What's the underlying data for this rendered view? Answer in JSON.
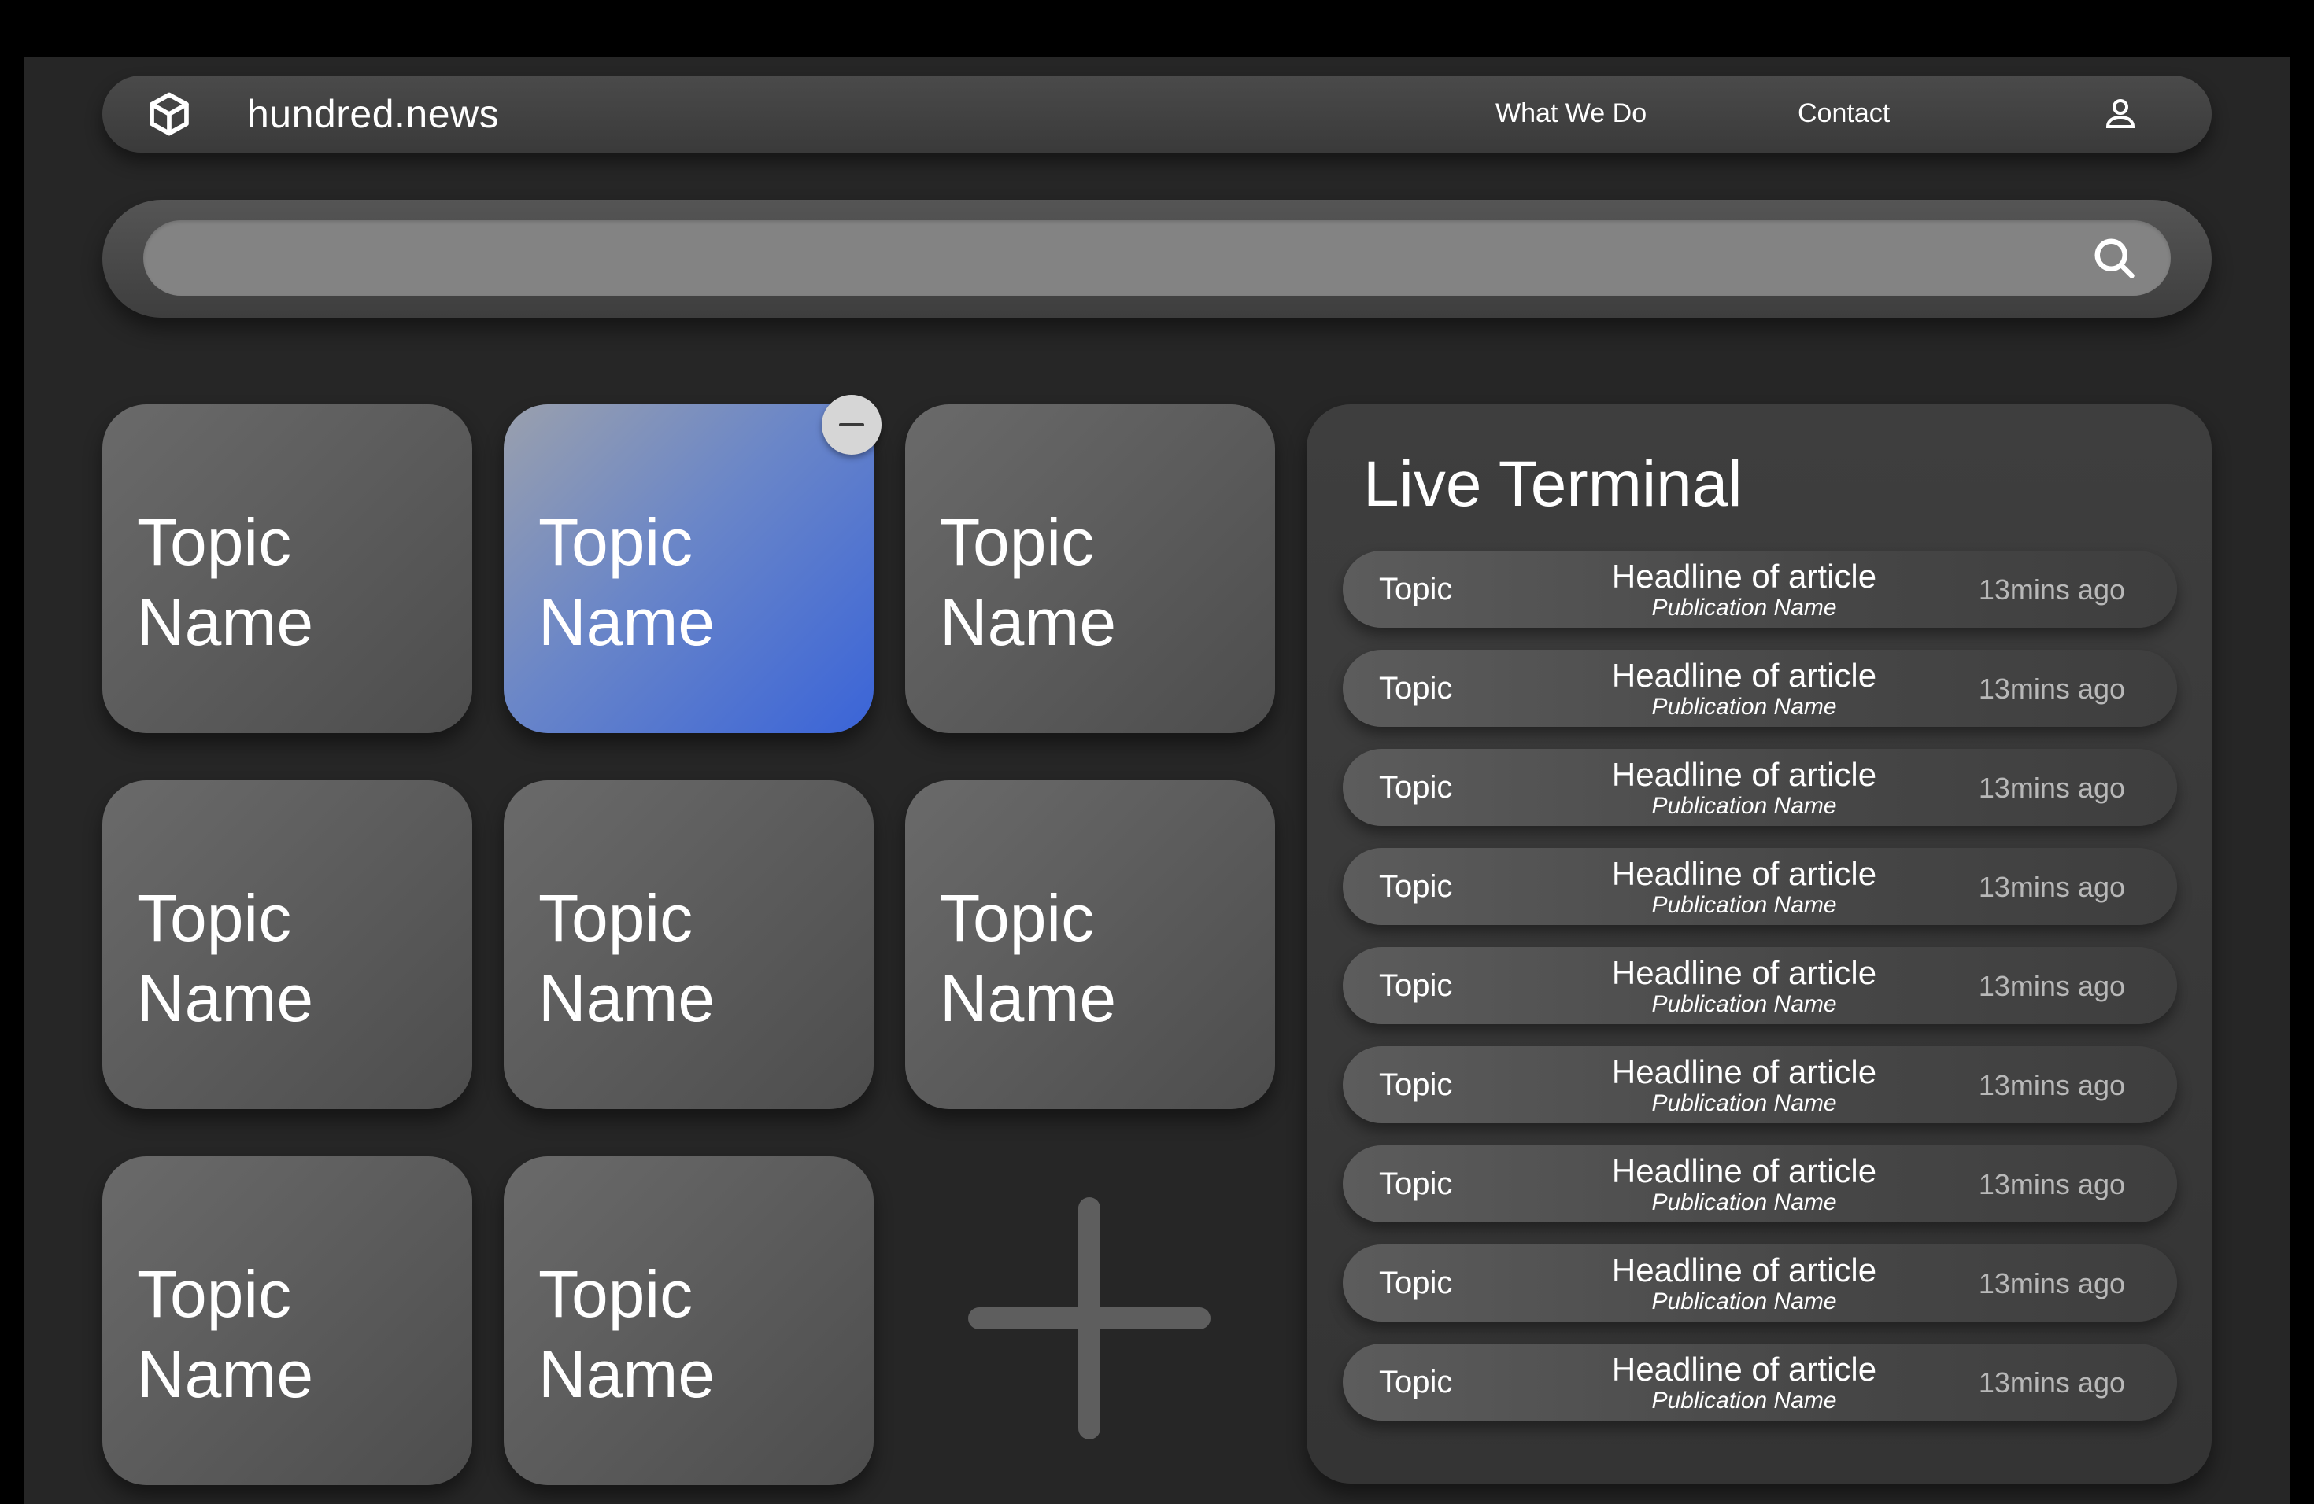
{
  "navbar": {
    "brand": "hundred.news",
    "logo_icon": "cube-icon",
    "links": [
      "What We Do",
      "Contact"
    ],
    "user_icon": "user-icon"
  },
  "search": {
    "value": "",
    "placeholder": "",
    "icon": "search-icon"
  },
  "topics": {
    "tiles": [
      {
        "label": "Topic\nName",
        "active": false
      },
      {
        "label": "Topic\nName",
        "active": true
      },
      {
        "label": "Topic\nName",
        "active": false
      },
      {
        "label": "Topic\nName",
        "active": false
      },
      {
        "label": "Topic\nName",
        "active": false
      },
      {
        "label": "Topic\nName",
        "active": false
      },
      {
        "label": "Topic\nName",
        "active": false
      },
      {
        "label": "Topic\nName",
        "active": false
      }
    ],
    "active_color": "#3a64d8",
    "add_icon": "plus-icon",
    "remove_icon": "minus-icon"
  },
  "terminal": {
    "title": "Live Terminal",
    "items": [
      {
        "topic": "Topic",
        "headline": "Headline of article",
        "publication": "Publication Name",
        "time": "13mins ago"
      },
      {
        "topic": "Topic",
        "headline": "Headline of article",
        "publication": "Publication Name",
        "time": "13mins ago"
      },
      {
        "topic": "Topic",
        "headline": "Headline of article",
        "publication": "Publication Name",
        "time": "13mins ago"
      },
      {
        "topic": "Topic",
        "headline": "Headline of article",
        "publication": "Publication Name",
        "time": "13mins ago"
      },
      {
        "topic": "Topic",
        "headline": "Headline of article",
        "publication": "Publication Name",
        "time": "13mins ago"
      },
      {
        "topic": "Topic",
        "headline": "Headline of article",
        "publication": "Publication Name",
        "time": "13mins ago"
      },
      {
        "topic": "Topic",
        "headline": "Headline of article",
        "publication": "Publication Name",
        "time": "13mins ago"
      },
      {
        "topic": "Topic",
        "headline": "Headline of article",
        "publication": "Publication Name",
        "time": "13mins ago"
      },
      {
        "topic": "Topic",
        "headline": "Headline of article",
        "publication": "Publication Name",
        "time": "13mins ago"
      }
    ]
  }
}
